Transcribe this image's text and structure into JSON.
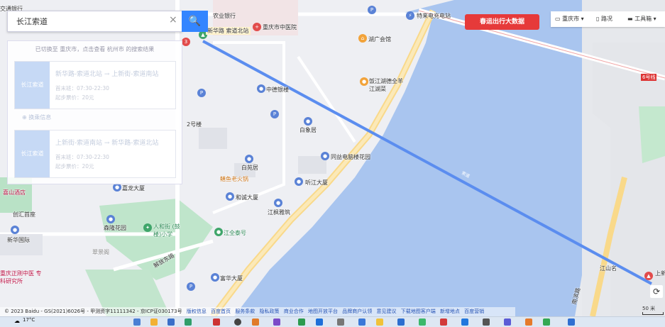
{
  "search": {
    "value": "长江索道",
    "clear_icon": "×",
    "search_icon": "🔍"
  },
  "results": {
    "notice": "已切换至 重庆市，点击查看 杭州市 的搜索结果",
    "routes": [
      {
        "tag": "长江索道",
        "name": "新华路-索道北站 → 上新街-索道南站",
        "hours": "首末班：07:30-22:30",
        "price": "起步票价：20元"
      },
      {
        "tag": "长江索道",
        "name": "上新街-索道南站 → 新华路-索道北站",
        "hours": "首末班：07:30-22:30",
        "price": "起步票价：20元"
      }
    ],
    "transfer": "换乘信息"
  },
  "banner": "春运出行大数据",
  "toolbar": {
    "city": "重庆市",
    "traffic": "路况",
    "tools": "工具箱"
  },
  "map_labels": {
    "station_north": "新华路 索道北站",
    "l1": "交通银行",
    "l2": "农业银行",
    "l3": "重庆市中医院",
    "l4": "特来电充电站",
    "l5": "湖广会馆",
    "l6": "饭江湖德全羊 江湖菜",
    "l7": "中德银楼",
    "l8": "2号楼",
    "l9": "白象居",
    "l10": "同益电脑楼花园",
    "l11": "白苑居",
    "l12": "鳝鱼老火锅",
    "l13": "听江大厦",
    "l14": "和诚大厦",
    "l15": "江枫雅筑",
    "l16": "嘉龙大厦",
    "l17": "森隆花园",
    "l18": "人和街 (鼓楼)小学",
    "l19": "江全泰号",
    "l20": "新华国际",
    "l21": "翠景阁",
    "l22": "解放东路",
    "l23": "富华大厦",
    "l24": "江山名",
    "l25": "南滨路",
    "l26": "喜山酒店",
    "l27": "创汇首座",
    "l28": "重庆正刚中医 专科研究所",
    "l29": "上新街",
    "l30": "6号线",
    "l31": "交通银行"
  },
  "footer": {
    "copyright": "© 2023 Baidu - GS(2021)6026号 - 甲测资字11111342 - 京ICP证030173号",
    "links": [
      "版权信息",
      "百度首页",
      "服务条款",
      "隐私政策",
      "商业合作",
      "地图开放平台",
      "品牌商户认领",
      "意见建议",
      "下载地图客户端",
      "新增地点",
      "百度营销"
    ]
  },
  "scale": "50 米",
  "weather": "17°C"
}
